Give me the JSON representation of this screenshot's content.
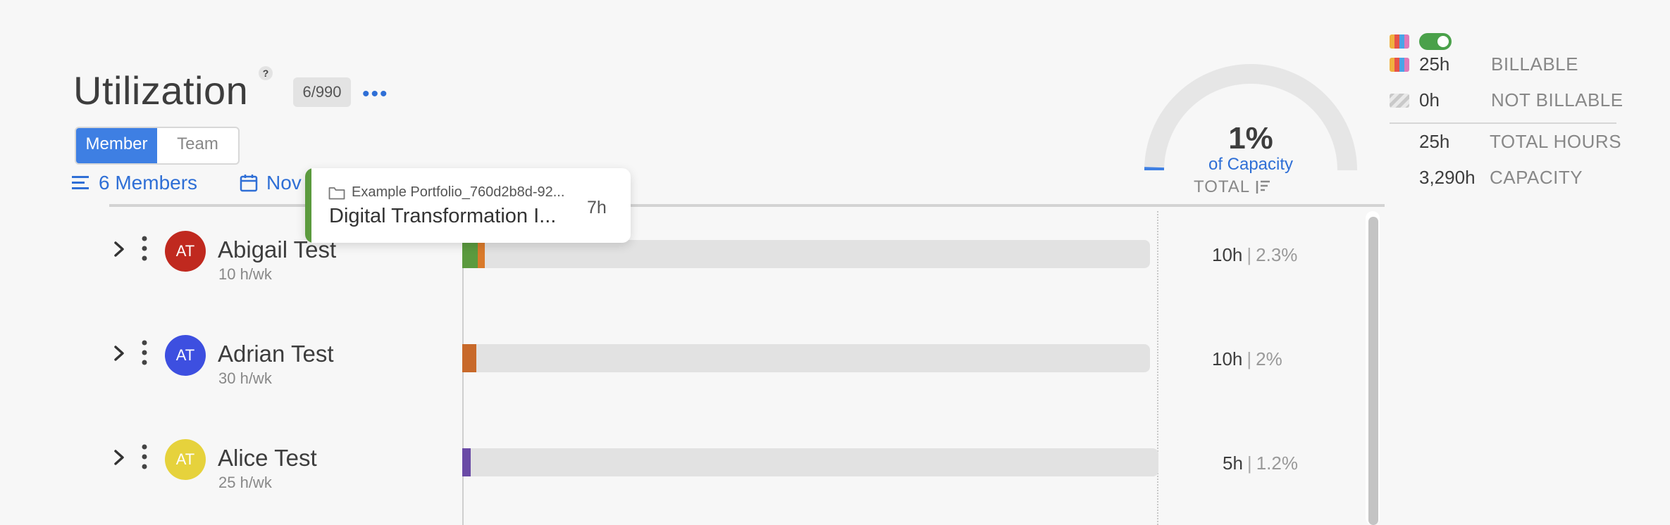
{
  "header": {
    "title": "Utilization",
    "help": "?",
    "count": "6/990",
    "more": "•••"
  },
  "view_toggle": {
    "member": "Member",
    "team": "Team"
  },
  "filters": {
    "members": "6 Members",
    "date": "Nov"
  },
  "tooltip": {
    "portfolio": "Example Portfolio_760d2b8d-92...",
    "project": "Digital Transformation I...",
    "hours": "7h",
    "accent": "#5b9a3e"
  },
  "gauge": {
    "percent": "1%",
    "subtitle": "of Capacity",
    "value_fraction": 0.01
  },
  "column_header": {
    "total": "TOTAL"
  },
  "legend": {
    "billable": {
      "value": "25h",
      "label": "BILLABLE"
    },
    "not_billable": {
      "value": "0h",
      "label": "NOT BILLABLE"
    },
    "total_hours": {
      "value": "25h",
      "label": "TOTAL HOURS"
    },
    "capacity": {
      "value": "3,290h",
      "label": "CAPACITY"
    },
    "billable_toggle_on": true
  },
  "members": [
    {
      "initials": "AT",
      "name": "Abigail Test",
      "rate": "10 h/wk",
      "hours": "10h",
      "pct": "2.3%",
      "avatar_color": "#c0291f",
      "segments": [
        {
          "color": "#5b9a3e",
          "fraction": 0.023
        },
        {
          "color": "#d97a2b",
          "fraction": 0.008
        }
      ]
    },
    {
      "initials": "AT",
      "name": "Adrian Test",
      "rate": "30 h/wk",
      "hours": "10h",
      "pct": "2%",
      "avatar_color": "#3d4fe0",
      "segments": [
        {
          "color": "#c8692a",
          "fraction": 0.02
        }
      ]
    },
    {
      "initials": "AT",
      "name": "Alice Test",
      "rate": "25 h/wk",
      "hours": "5h",
      "pct": "1.2%",
      "avatar_color": "#e6d23c",
      "segments": [
        {
          "color": "#6a4aa6",
          "fraction": 0.012
        }
      ]
    }
  ],
  "separator": "|"
}
